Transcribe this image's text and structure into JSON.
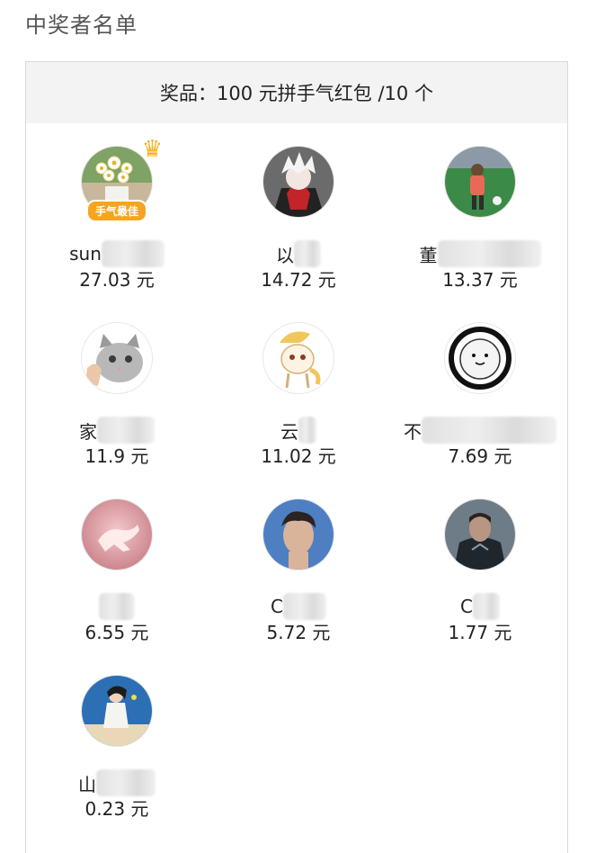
{
  "page": {
    "title": "中奖者名单"
  },
  "prize": {
    "text": "奖品：100 元拼手气红包 /10 个"
  },
  "best_badge": "手气最佳",
  "winners": [
    {
      "name": "sun",
      "amount": "27.03 元",
      "avatar": "flowers-avatar",
      "best": true
    },
    {
      "name": "以",
      "amount": "14.72 元",
      "avatar": "anime-white-hair-avatar"
    },
    {
      "name": "董",
      "amount": "13.37 元",
      "avatar": "child-playing-avatar"
    },
    {
      "name": "家",
      "amount": "11.9 元",
      "avatar": "grey-cat-avatar"
    },
    {
      "name": "云",
      "amount": "11.02 元",
      "avatar": "cartoon-pony-avatar"
    },
    {
      "name": "不",
      "amount": "7.69 元",
      "avatar": "sketch-bird-avatar"
    },
    {
      "name": "",
      "amount": "6.55 元",
      "avatar": "pink-hand-avatar"
    },
    {
      "name": "C",
      "amount": "5.72 元",
      "avatar": "man-portrait-avatar"
    },
    {
      "name": "C",
      "amount": "1.77 元",
      "avatar": "dark-hero-avatar"
    },
    {
      "name": "山",
      "amount": "0.23 元",
      "avatar": "girl-illustration-avatar"
    }
  ]
}
